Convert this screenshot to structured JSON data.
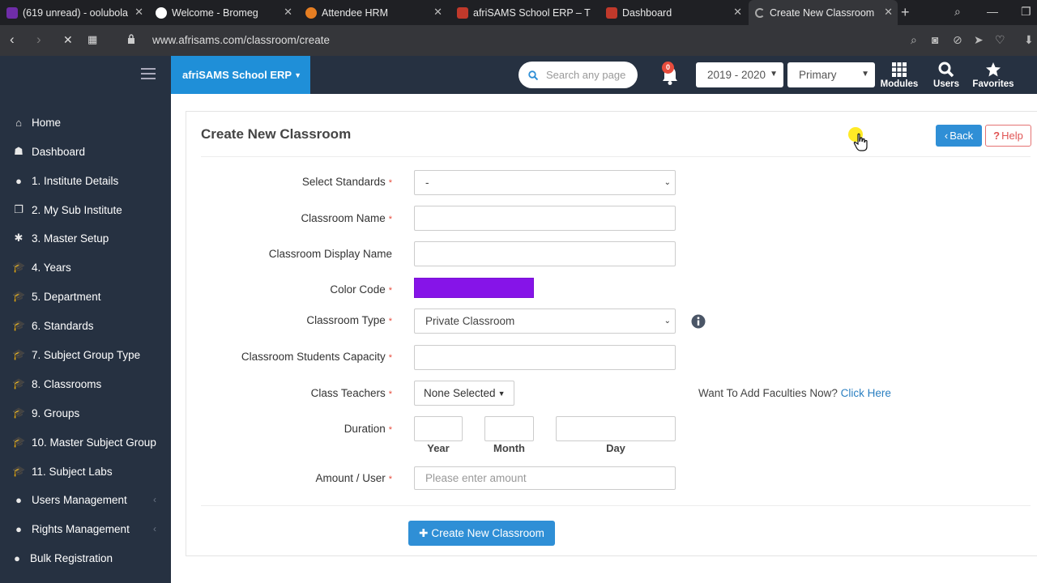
{
  "browser": {
    "tabs": [
      {
        "label": "(619 unread) - oolubola",
        "icon_color": "#6f2da8",
        "active": false
      },
      {
        "label": "Welcome - Bromeg",
        "icon_color": "#ffffff",
        "active": false
      },
      {
        "label": "Attendee HRM",
        "icon_color": "#e67e22",
        "active": false
      },
      {
        "label": "afriSAMS School ERP – T",
        "icon_color": "#c0392b",
        "active": false
      },
      {
        "label": "Dashboard",
        "icon_color": "#c0392b",
        "active": false
      },
      {
        "label": "Create New Classroom",
        "icon_color": "#888888",
        "active": true
      }
    ],
    "new_tab": "+",
    "url": "www.afrisams.com/classroom/create"
  },
  "header": {
    "brand": "afriSAMS School ERP",
    "search_placeholder": "Search any page",
    "notification_count": "0",
    "year_select": "2019 - 2020",
    "level_select": "Primary",
    "buttons": {
      "modules": "Modules",
      "users": "Users",
      "favorites": "Favorites"
    }
  },
  "sidebar": {
    "items": [
      {
        "label": "Home",
        "icon": "home-icon",
        "glyph": "⌂"
      },
      {
        "label": "Dashboard",
        "icon": "dashboard-icon",
        "glyph": "☗"
      },
      {
        "label": "1. Institute Details",
        "icon": "globe-icon",
        "glyph": "●"
      },
      {
        "label": "2. My Sub Institute",
        "icon": "copy-icon",
        "glyph": "❐"
      },
      {
        "label": "3. Master Setup",
        "icon": "gear-icon",
        "glyph": "✱"
      },
      {
        "label": "4. Years",
        "icon": "graduation-cap-icon",
        "glyph": "🎓"
      },
      {
        "label": "5. Department",
        "icon": "graduation-cap-icon",
        "glyph": "🎓"
      },
      {
        "label": "6. Standards",
        "icon": "graduation-cap-icon",
        "glyph": "🎓"
      },
      {
        "label": "7. Subject Group Type",
        "icon": "graduation-cap-icon",
        "glyph": "🎓"
      },
      {
        "label": "8. Classrooms",
        "icon": "graduation-cap-icon",
        "glyph": "🎓"
      },
      {
        "label": "9. Groups",
        "icon": "graduation-cap-icon",
        "glyph": "🎓"
      },
      {
        "label": "10. Master Subject Group",
        "icon": "graduation-cap-icon",
        "glyph": "🎓"
      },
      {
        "label": "11. Subject Labs",
        "icon": "graduation-cap-icon",
        "glyph": "🎓"
      },
      {
        "label": "Users Management",
        "icon": "user-icon",
        "glyph": "●",
        "arrow": "‹"
      },
      {
        "label": "Rights Management",
        "icon": "user-icon",
        "glyph": "●",
        "arrow": "‹"
      },
      {
        "label": "Bulk Registration",
        "icon": "user-plus-icon",
        "glyph": "●"
      }
    ]
  },
  "page": {
    "title": "Create New Classroom",
    "back_label": "Back",
    "help_label": "Help",
    "form": {
      "standards": {
        "label": "Select Standards",
        "value": "-"
      },
      "classroom_name": {
        "label": "Classroom Name",
        "value": ""
      },
      "display_name": {
        "label": "Classroom Display Name",
        "value": ""
      },
      "color_code": {
        "label": "Color Code",
        "value": "#8614e8"
      },
      "classroom_type": {
        "label": "Classroom Type",
        "value": "Private Classroom"
      },
      "capacity": {
        "label": "Classroom Students Capacity",
        "value": ""
      },
      "class_teachers": {
        "label": "Class Teachers",
        "value": "None Selected"
      },
      "faculty_prompt": "Want To Add Faculties Now?",
      "faculty_link": "Click Here",
      "duration": {
        "label": "Duration",
        "year": "Year",
        "month": "Month",
        "day": "Day"
      },
      "amount": {
        "label": "Amount / User",
        "placeholder": "Please enter amount"
      }
    },
    "submit_label": "Create New Classroom"
  }
}
